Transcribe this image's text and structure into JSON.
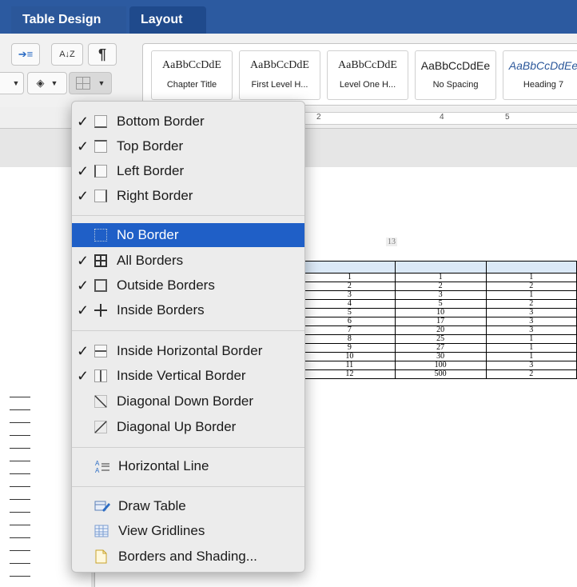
{
  "tabs": {
    "table_design": "Table Design",
    "layout": "Layout"
  },
  "styles": [
    {
      "sample": "AaBbCcDdE",
      "name": "Chapter Title"
    },
    {
      "sample": "AaBbCcDdE",
      "name": "First Level H..."
    },
    {
      "sample": "AaBbCcDdE",
      "name": "Level One H..."
    },
    {
      "sample": "AaBbCcDdEe",
      "name": "No Spacing"
    },
    {
      "sample": "AaBbCcDdEe",
      "name": "Heading 7"
    }
  ],
  "ruler": {
    "n2": "2",
    "n4": "4",
    "n5": "5"
  },
  "document": {
    "page_number": "13",
    "table_rows": [
      [
        "1",
        "1",
        "1"
      ],
      [
        "2",
        "2",
        "2"
      ],
      [
        "3",
        "3",
        "1"
      ],
      [
        "4",
        "5",
        "2"
      ],
      [
        "5",
        "10",
        "3"
      ],
      [
        "6",
        "17",
        "3"
      ],
      [
        "7",
        "20",
        "3"
      ],
      [
        "8",
        "25",
        "1"
      ],
      [
        "9",
        "27",
        "1"
      ],
      [
        "10",
        "30",
        "1"
      ],
      [
        "11",
        "100",
        "3"
      ],
      [
        "12",
        "500",
        "2"
      ]
    ]
  },
  "menu": {
    "bottom_border": "Bottom Border",
    "top_border": "Top Border",
    "left_border": "Left Border",
    "right_border": "Right Border",
    "no_border": "No Border",
    "all_borders": "All Borders",
    "outside_borders": "Outside Borders",
    "inside_borders": "Inside Borders",
    "inside_horizontal": "Inside Horizontal Border",
    "inside_vertical": "Inside Vertical Border",
    "diagonal_down": "Diagonal Down Border",
    "diagonal_up": "Diagonal Up Border",
    "horizontal_line": "Horizontal Line",
    "draw_table": "Draw Table",
    "view_gridlines": "View Gridlines",
    "borders_shading": "Borders and Shading...",
    "check": "✓"
  },
  "colors": {
    "accent": "#1f5fc7",
    "tabbar": "#2c5aa0"
  }
}
